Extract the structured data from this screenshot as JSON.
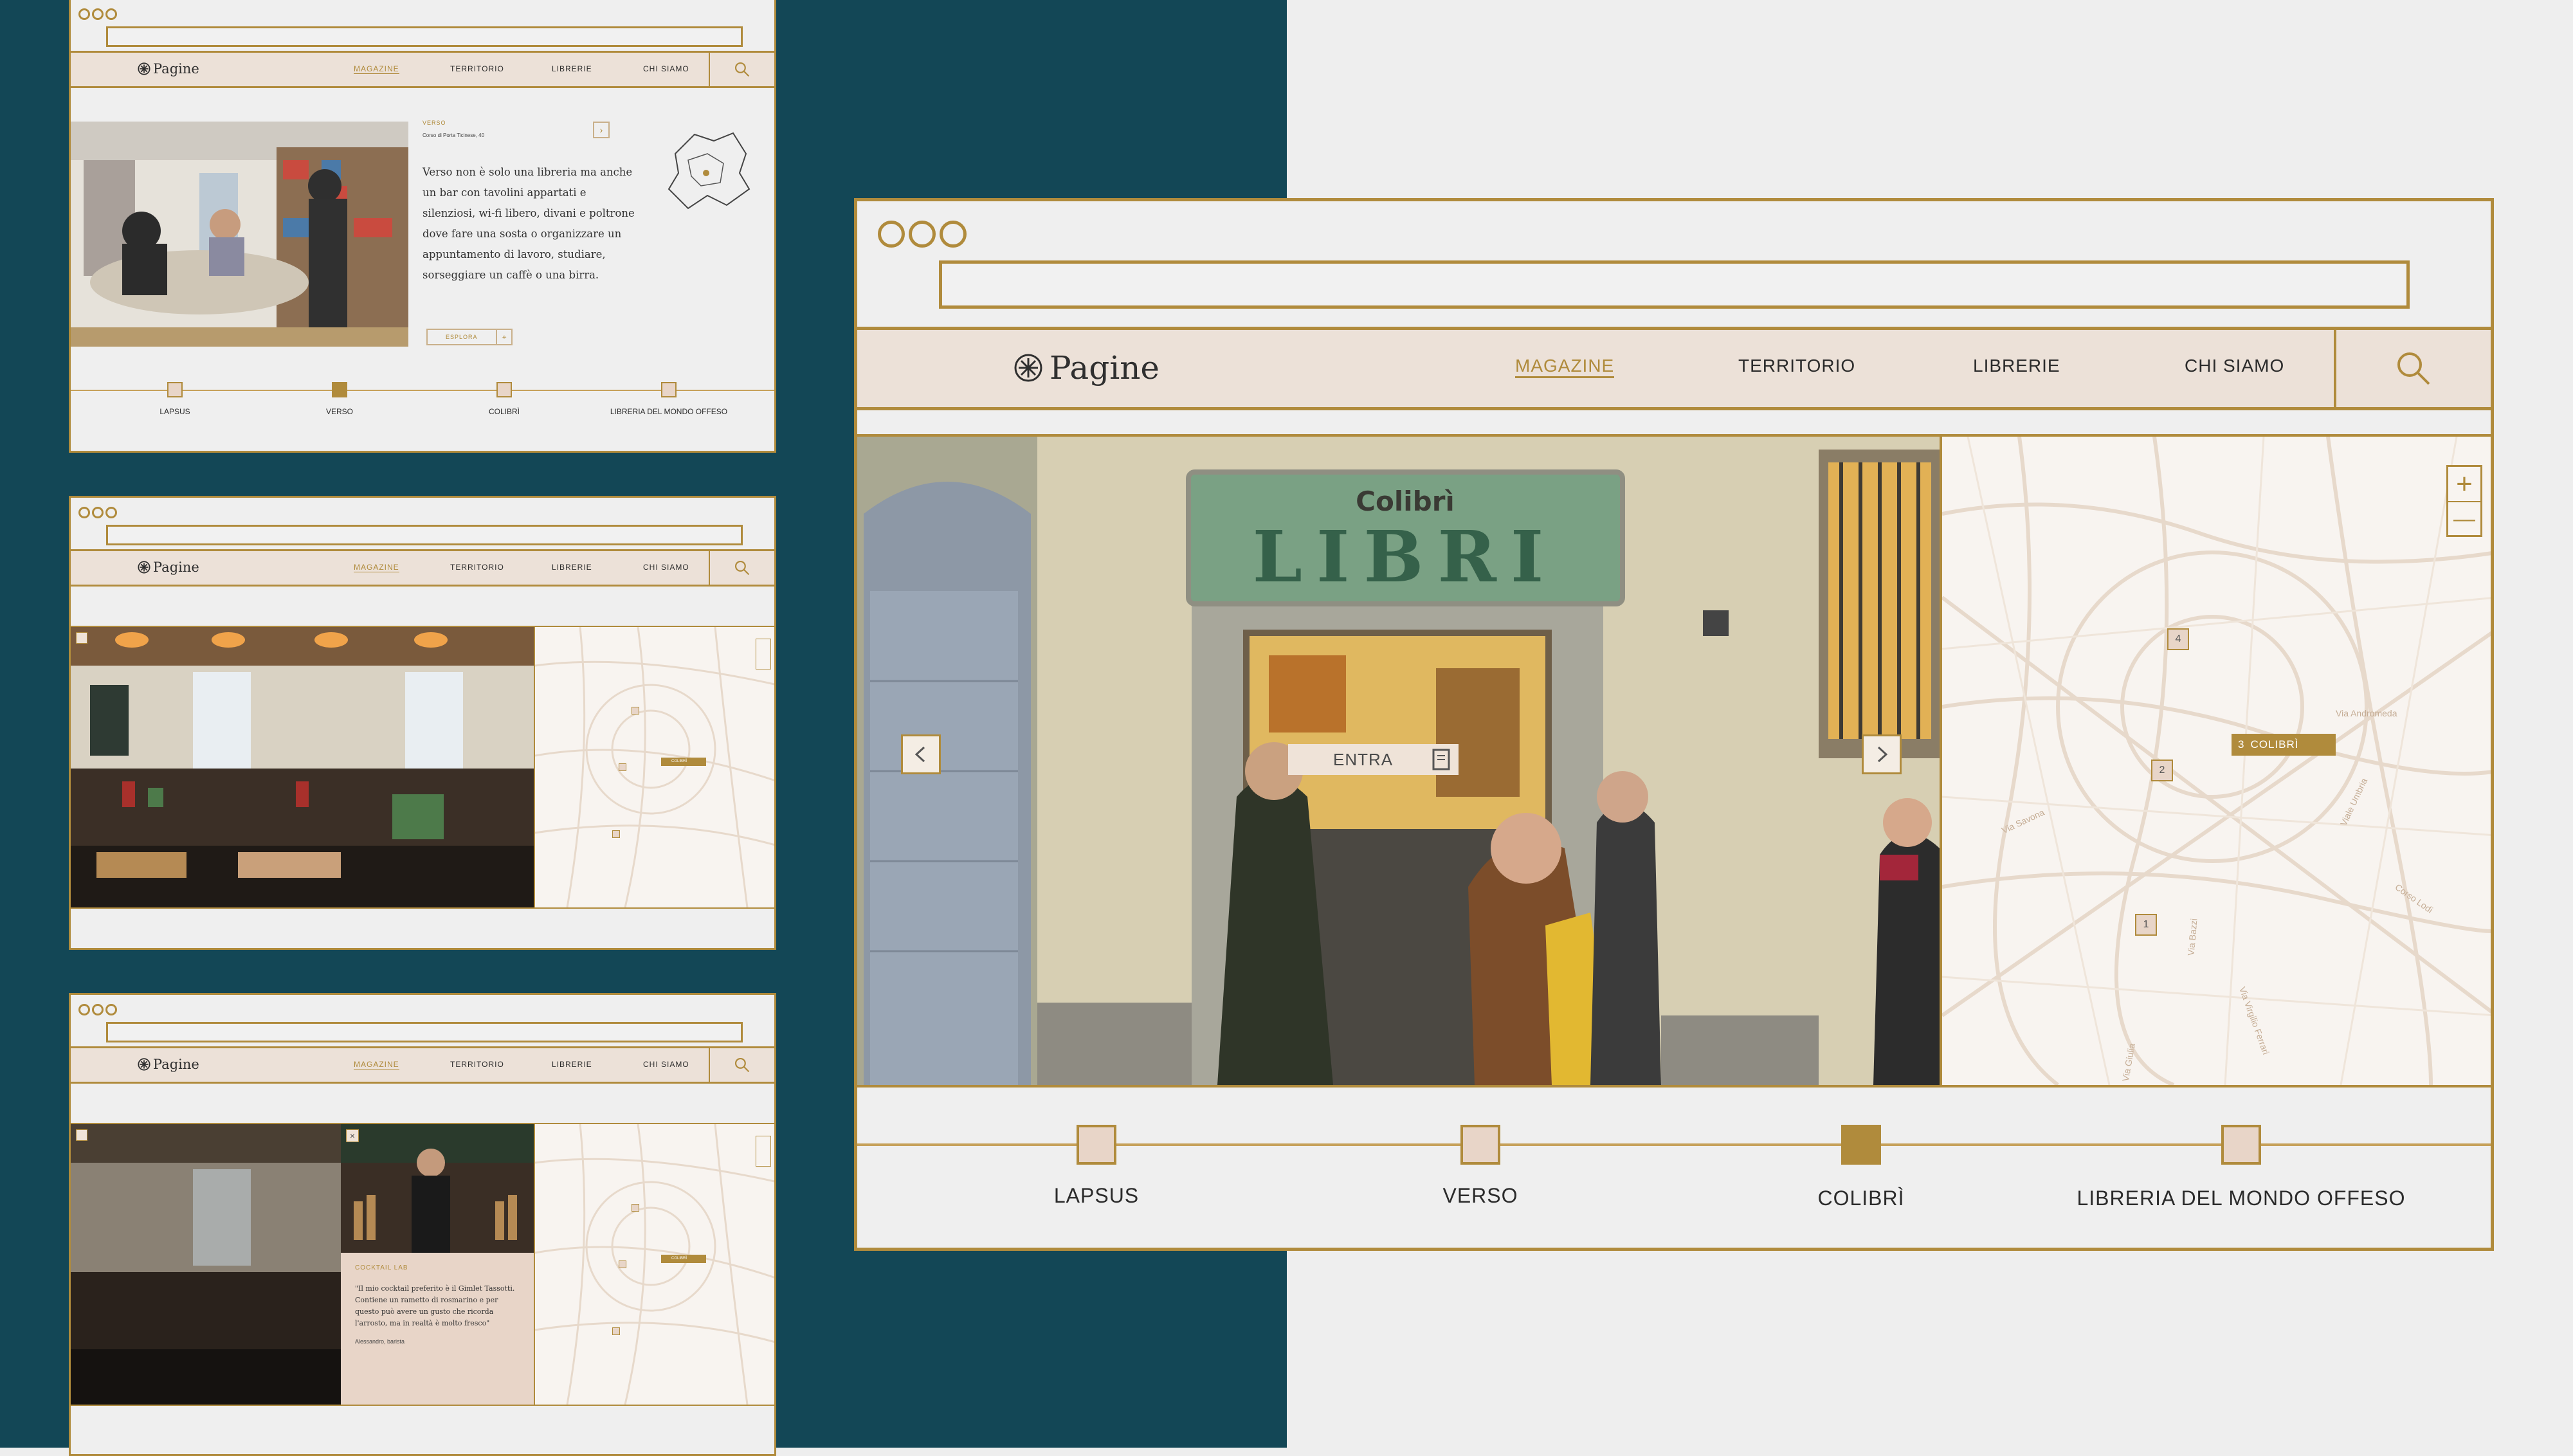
{
  "brand": "Pagine",
  "nav": {
    "items": [
      "MAGAZINE",
      "TERRITORIO",
      "LIBRERIE",
      "CHI SIAMO"
    ],
    "active": "MAGAZINE"
  },
  "timeline": [
    "LAPSUS",
    "VERSO",
    "COLIBRÌ",
    "LIBRERIA DEL MONDO OFFESO"
  ],
  "main": {
    "active_stop": "COLIBRÌ",
    "enter_label": "ENTRA",
    "shop_sign_top": "Colibrì",
    "shop_sign_main": "LIBRI",
    "map": {
      "selected_pin_number": "3",
      "selected_pin_label": "COLIBRÌ",
      "pins": [
        "4",
        "2",
        "1"
      ],
      "streets": [
        "Via Andromeda",
        "Via Savona",
        "Viale Umbria",
        "Corso Lodi",
        "Via Bazzi",
        "Via Virgilio Ferrari",
        "Via Giulia"
      ],
      "zoom_in": "+",
      "zoom_out": "—"
    }
  },
  "thumb1": {
    "active_stop": "VERSO",
    "store_name": "VERSO",
    "address": "Corso di Porta Ticinese, 40",
    "description": "Verso non è solo una libreria ma anche un bar con tavolini appartati e silenziosi, wi-fi libero, divani e poltrone dove fare una sosta o organizzare un appuntamento di lavoro, studiare, sorseggiare un caffè o una birra.",
    "cta": "ESPLORA"
  },
  "thumb2": {
    "map_pin_label": "COLIBRÌ"
  },
  "thumb3": {
    "caption_title": "COCKTAIL LAB",
    "quote": "\"Il mio cocktail preferito è il Gimlet Tassotti. Contiene un rametto di rosmarino e per questo può avere un gusto che ricorda l'arrosto, ma in realtà è molto fresco\"",
    "author": "Alessandro, barista",
    "map_pin_label": "COLIBRÌ"
  },
  "colors": {
    "teal": "#134756",
    "gold": "#b08b3c",
    "nav_bg": "#ece1d8",
    "page_bg": "#eeeeee"
  }
}
